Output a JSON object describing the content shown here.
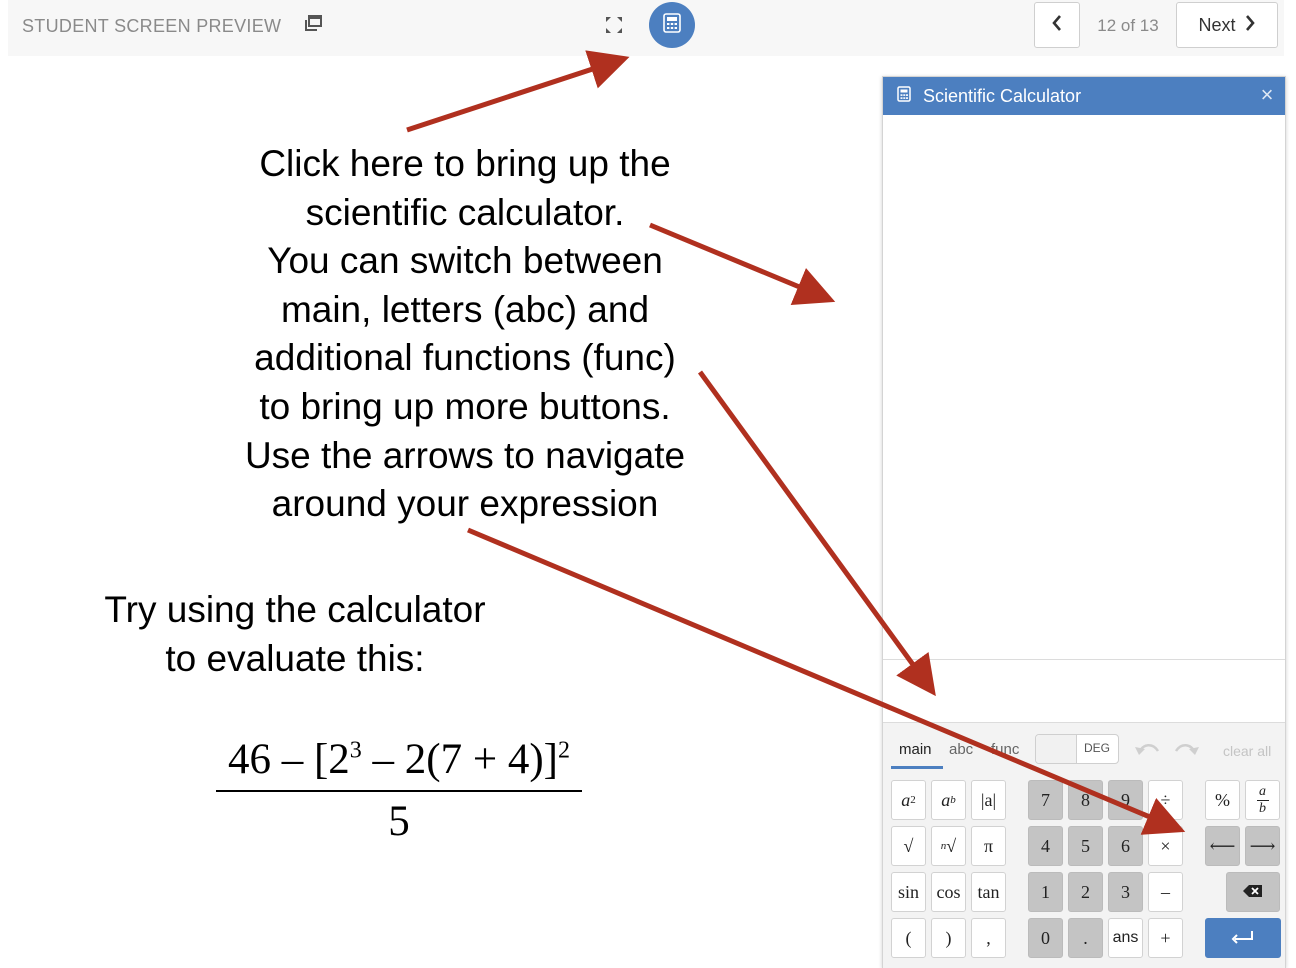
{
  "header": {
    "preview_label": "STUDENT SCREEN PREVIEW",
    "preview_icon": "window-icon",
    "expand_icon": "expand-icon",
    "calc_button_icon": "calculator-icon",
    "prev_icon": "chevron-left-icon",
    "counter": "12 of 13",
    "next_label": "Next",
    "next_icon": "chevron-right-icon"
  },
  "instructions": {
    "lines": [
      "Click here to bring up the",
      "scientific calculator.",
      "You can switch between",
      "main, letters (abc) and",
      "additional functions (func)",
      "to bring up more buttons.",
      "Use the arrows to navigate",
      "around your expression"
    ],
    "try_lines": [
      "Try using the calculator",
      "to evaluate this:"
    ]
  },
  "formula": {
    "n1": "46 – [2",
    "n2": "3",
    "n3": " – 2(7 + 4)]",
    "n4": "2",
    "denominator": "5"
  },
  "calculator": {
    "title": "Scientific Calculator",
    "title_icon": "calculator-icon",
    "close": "×",
    "tabs": {
      "main": "main",
      "abc": "abc",
      "func": "func"
    },
    "deg_label": "DEG",
    "clear_all": "clear all",
    "keys": {
      "abs": "|a|",
      "pi": "π",
      "sqrt": "√",
      "sin": "sin",
      "cos": "cos",
      "tan": "tan",
      "lparen": "(",
      "rparen": ")",
      "comma": ",",
      "k7": "7",
      "k8": "8",
      "k9": "9",
      "k4": "4",
      "k5": "5",
      "k6": "6",
      "k1": "1",
      "k2": "2",
      "k3": "3",
      "k0": "0",
      "dot": ".",
      "ans": "ans",
      "divide": "÷",
      "times": "×",
      "minus": "–",
      "plus": "+",
      "percent": "%",
      "left": "⟵",
      "right": "⟶"
    }
  },
  "colors": {
    "accent": "#4c7fc0",
    "arrow": "#b0301f"
  }
}
